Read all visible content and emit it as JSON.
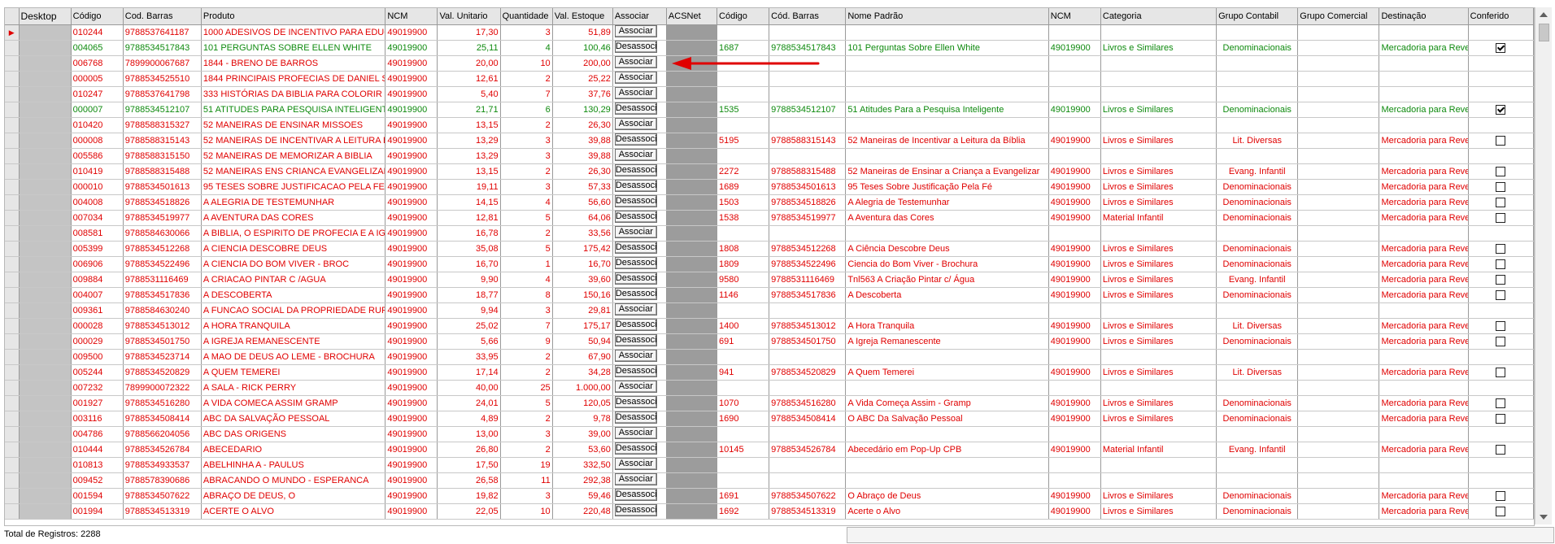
{
  "headers": {
    "desktop": "Desktop",
    "codigo": "Código",
    "cod_barras": "Cod. Barras",
    "produto": "Produto",
    "ncm": "NCM",
    "val_unitario": "Val. Unitario",
    "quantidade": "Quantidade",
    "val_estoque": "Val. Estoque",
    "associar": "Associar",
    "acsnet": "ACSNet",
    "codigo2": "Código",
    "cod_barras2": "Cód. Barras",
    "nome_padrao": "Nome Padrão",
    "ncm2": "NCM",
    "categoria": "Categoria",
    "grupo_contabil": "Grupo Contabil",
    "grupo_comercial": "Grupo Comercial",
    "destinacao": "Destinação",
    "conferido": "Conferido"
  },
  "buttons": {
    "associar": "Associar",
    "desassociar": "Desassociar"
  },
  "row_indicator": "▶",
  "rows": [
    {
      "codigo": "010244",
      "barras": "9788537641187",
      "produto": "1000 ADESIVOS DE INCENTIVO PARA EDUCA",
      "ncm": "49019900",
      "vu": "17,30",
      "qt": "3",
      "ve": "51,89",
      "btn": "Associar",
      "status": "red",
      "linked": false,
      "current": true
    },
    {
      "codigo": "004065",
      "barras": "9788534517843",
      "produto": "101 PERGUNTAS SOBRE ELLEN WHITE",
      "ncm": "49019900",
      "vu": "25,11",
      "qt": "4",
      "ve": "100,46",
      "btn": "Desassociar",
      "status": "green",
      "linked": true,
      "c2": "1687",
      "b2": "9788534517843",
      "nome": "101 Perguntas Sobre Ellen White",
      "ncm2": "49019900",
      "cat": "Livros e Similares",
      "gc": "Denominacionais",
      "gcom": "",
      "dest": "Mercadoria para Reve",
      "conf": true
    },
    {
      "codigo": "006768",
      "barras": "7899900067687",
      "produto": "1844 - BRENO DE BARROS",
      "ncm": "49019900",
      "vu": "20,00",
      "qt": "10",
      "ve": "200,00",
      "btn": "Associar",
      "status": "red",
      "linked": false
    },
    {
      "codigo": "000005",
      "barras": "9788534525510",
      "produto": "1844 PRINCIPAIS PROFECIAS DE DANIEL S",
      "ncm": "49019900",
      "vu": "12,61",
      "qt": "2",
      "ve": "25,22",
      "btn": "Associar",
      "status": "red",
      "linked": false
    },
    {
      "codigo": "010247",
      "barras": "9788537641798",
      "produto": "333 HISTÓRIAS DA BIBLIA PARA COLORIR",
      "ncm": "49019900",
      "vu": "5,40",
      "qt": "7",
      "ve": "37,76",
      "btn": "Associar",
      "status": "red",
      "linked": false
    },
    {
      "codigo": "000007",
      "barras": "9788534512107",
      "produto": "51 ATITUDES PARA PESQUISA INTELIGENTE",
      "ncm": "49019900",
      "vu": "21,71",
      "qt": "6",
      "ve": "130,29",
      "btn": "Desassociar",
      "status": "green",
      "linked": true,
      "c2": "1535",
      "b2": "9788534512107",
      "nome": "51 Atitudes Para a Pesquisa Inteligente",
      "ncm2": "49019900",
      "cat": "Livros e Similares",
      "gc": "Denominacionais",
      "gcom": "",
      "dest": "Mercadoria para Reve",
      "conf": true
    },
    {
      "codigo": "010420",
      "barras": "9788588315327",
      "produto": "52 MANEIRAS DE ENSINAR MISSOES",
      "ncm": "49019900",
      "vu": "13,15",
      "qt": "2",
      "ve": "26,30",
      "btn": "Associar",
      "status": "red",
      "linked": false
    },
    {
      "codigo": "000008",
      "barras": "9788588315143",
      "produto": "52 MANEIRAS DE INCENTIVAR A LEITURA BIB",
      "ncm": "49019900",
      "vu": "13,29",
      "qt": "3",
      "ve": "39,88",
      "btn": "Desassociar",
      "status": "red",
      "linked": true,
      "c2": "5195",
      "b2": "9788588315143",
      "nome": "52 Maneiras de Incentivar a Leitura da Bíblia",
      "ncm2": "49019900",
      "cat": "Livros e Similares",
      "gc": "Lit. Diversas",
      "gcom": "",
      "dest": "Mercadoria para Reve",
      "conf": false
    },
    {
      "codigo": "005586",
      "barras": "9788588315150",
      "produto": "52 MANEIRAS DE MEMORIZAR A BIBLIA",
      "ncm": "49019900",
      "vu": "13,29",
      "qt": "3",
      "ve": "39,88",
      "btn": "Associar",
      "status": "red",
      "linked": false
    },
    {
      "codigo": "010419",
      "barras": "9788588315488",
      "produto": "52 MANEIRAS ENS CRIANCA EVANGELIZAR",
      "ncm": "49019900",
      "vu": "13,15",
      "qt": "2",
      "ve": "26,30",
      "btn": "Desassociar",
      "status": "red",
      "linked": true,
      "c2": "2272",
      "b2": "9788588315488",
      "nome": "52 Maneiras de Ensinar a Criança a Evangelizar",
      "ncm2": "49019900",
      "cat": "Livros e Similares",
      "gc": "Evang. Infantil",
      "gcom": "",
      "dest": "Mercadoria para Reve",
      "conf": false
    },
    {
      "codigo": "000010",
      "barras": "9788534501613",
      "produto": "95 TESES SOBRE JUSTIFICACAO PELA FE",
      "ncm": "49019900",
      "vu": "19,11",
      "qt": "3",
      "ve": "57,33",
      "btn": "Desassociar",
      "status": "red",
      "linked": true,
      "c2": "1689",
      "b2": "9788534501613",
      "nome": "95 Teses Sobre Justificação Pela Fé",
      "ncm2": "49019900",
      "cat": "Livros e Similares",
      "gc": "Denominacionais",
      "gcom": "",
      "dest": "Mercadoria para Reve",
      "conf": false
    },
    {
      "codigo": "004008",
      "barras": "9788534518826",
      "produto": "A ALEGRIA DE TESTEMUNHAR",
      "ncm": "49019900",
      "vu": "14,15",
      "qt": "4",
      "ve": "56,60",
      "btn": "Desassociar",
      "status": "red",
      "linked": true,
      "c2": "1503",
      "b2": "9788534518826",
      "nome": "A Alegria de Testemunhar",
      "ncm2": "49019900",
      "cat": "Livros e Similares",
      "gc": "Denominacionais",
      "gcom": "",
      "dest": "Mercadoria para Reve",
      "conf": false
    },
    {
      "codigo": "007034",
      "barras": "9788534519977",
      "produto": "A AVENTURA DAS CORES",
      "ncm": "49019900",
      "vu": "12,81",
      "qt": "5",
      "ve": "64,06",
      "btn": "Desassociar",
      "status": "red",
      "linked": true,
      "c2": "1538",
      "b2": "9788534519977",
      "nome": "A Aventura das Cores",
      "ncm2": "49019900",
      "cat": "Material Infantil",
      "gc": "Denominacionais",
      "gcom": "",
      "dest": "Mercadoria para Reve",
      "conf": false
    },
    {
      "codigo": "008581",
      "barras": "9788584630066",
      "produto": "A BIBLIA, O ESPIRITO DE PROFECIA E A IGRE",
      "ncm": "49019900",
      "vu": "16,78",
      "qt": "2",
      "ve": "33,56",
      "btn": "Associar",
      "status": "red",
      "linked": false
    },
    {
      "codigo": "005399",
      "barras": "9788534512268",
      "produto": "A CIENCIA DESCOBRE DEUS",
      "ncm": "49019900",
      "vu": "35,08",
      "qt": "5",
      "ve": "175,42",
      "btn": "Desassociar",
      "status": "red",
      "linked": true,
      "c2": "1808",
      "b2": "9788534512268",
      "nome": "A Ciência Descobre Deus",
      "ncm2": "49019900",
      "cat": "Livros e Similares",
      "gc": "Denominacionais",
      "gcom": "",
      "dest": "Mercadoria para Reve",
      "conf": false
    },
    {
      "codigo": "006906",
      "barras": "9788534522496",
      "produto": "A CIENCIA DO BOM VIVER - BROC",
      "ncm": "49019900",
      "vu": "16,70",
      "qt": "1",
      "ve": "16,70",
      "btn": "Desassociar",
      "status": "red",
      "linked": true,
      "c2": "1809",
      "b2": "9788534522496",
      "nome": "Ciencia do Bom Viver - Brochura",
      "ncm2": "49019900",
      "cat": "Livros e Similares",
      "gc": "Denominacionais",
      "gcom": "",
      "dest": "Mercadoria para Reve",
      "conf": false
    },
    {
      "codigo": "009884",
      "barras": "9788531116469",
      "produto": "A CRIACAO PINTAR C /AGUA",
      "ncm": "49019900",
      "vu": "9,90",
      "qt": "4",
      "ve": "39,60",
      "btn": "Desassociar",
      "status": "red",
      "linked": true,
      "c2": "9580",
      "b2": "9788531116469",
      "nome": "Tnl563 A Criação Pintar c/ Água",
      "ncm2": "49019900",
      "cat": "Livros e Similares",
      "gc": "Evang. Infantil",
      "gcom": "",
      "dest": "Mercadoria para Reve",
      "conf": false
    },
    {
      "codigo": "004007",
      "barras": "9788534517836",
      "produto": "A DESCOBERTA",
      "ncm": "49019900",
      "vu": "18,77",
      "qt": "8",
      "ve": "150,16",
      "btn": "Desassociar",
      "status": "red",
      "linked": true,
      "c2": "1146",
      "b2": "9788534517836",
      "nome": "A Descoberta",
      "ncm2": "49019900",
      "cat": "Livros e Similares",
      "gc": "Denominacionais",
      "gcom": "",
      "dest": "Mercadoria para Reve",
      "conf": false
    },
    {
      "codigo": "009361",
      "barras": "9788584630240",
      "produto": "A FUNCAO SOCIAL DA PROPRIEDADE RURAL",
      "ncm": "49019900",
      "vu": "9,94",
      "qt": "3",
      "ve": "29,81",
      "btn": "Associar",
      "status": "red",
      "linked": false
    },
    {
      "codigo": "000028",
      "barras": "9788534513012",
      "produto": "A HORA TRANQUILA",
      "ncm": "49019900",
      "vu": "25,02",
      "qt": "7",
      "ve": "175,17",
      "btn": "Desassociar",
      "status": "red",
      "linked": true,
      "c2": "1400",
      "b2": "9788534513012",
      "nome": "A Hora Tranquila",
      "ncm2": "49019900",
      "cat": "Livros e Similares",
      "gc": "Lit. Diversas",
      "gcom": "",
      "dest": "Mercadoria para Reve",
      "conf": false
    },
    {
      "codigo": "000029",
      "barras": "9788534501750",
      "produto": "A IGREJA REMANESCENTE",
      "ncm": "49019900",
      "vu": "5,66",
      "qt": "9",
      "ve": "50,94",
      "btn": "Desassociar",
      "status": "red",
      "linked": true,
      "c2": "691",
      "b2": "9788534501750",
      "nome": "A Igreja Remanescente",
      "ncm2": "49019900",
      "cat": "Livros e Similares",
      "gc": "Denominacionais",
      "gcom": "",
      "dest": "Mercadoria para Reve",
      "conf": false
    },
    {
      "codigo": "009500",
      "barras": "9788534523714",
      "produto": "A MAO DE DEUS AO LEME - BROCHURA",
      "ncm": "49019900",
      "vu": "33,95",
      "qt": "2",
      "ve": "67,90",
      "btn": "Associar",
      "status": "red",
      "linked": false
    },
    {
      "codigo": "005244",
      "barras": "9788534520829",
      "produto": "A QUEM TEMEREI",
      "ncm": "49019900",
      "vu": "17,14",
      "qt": "2",
      "ve": "34,28",
      "btn": "Desassociar",
      "status": "red",
      "linked": true,
      "c2": "941",
      "b2": "9788534520829",
      "nome": "A Quem Temerei",
      "ncm2": "49019900",
      "cat": "Livros e Similares",
      "gc": "Lit. Diversas",
      "gcom": "",
      "dest": "Mercadoria para Reve",
      "conf": false
    },
    {
      "codigo": "007232",
      "barras": "7899900072322",
      "produto": "A SALA - RICK PERRY",
      "ncm": "49019900",
      "vu": "40,00",
      "qt": "25",
      "ve": "1.000,00",
      "btn": "Associar",
      "status": "red",
      "linked": false
    },
    {
      "codigo": "001927",
      "barras": "9788534516280",
      "produto": "A VIDA COMECA ASSIM GRAMP",
      "ncm": "49019900",
      "vu": "24,01",
      "qt": "5",
      "ve": "120,05",
      "btn": "Desassociar",
      "status": "red",
      "linked": true,
      "c2": "1070",
      "b2": "9788534516280",
      "nome": "A Vida Começa Assim - Gramp",
      "ncm2": "49019900",
      "cat": "Livros e Similares",
      "gc": "Denominacionais",
      "gcom": "",
      "dest": "Mercadoria para Reve",
      "conf": false
    },
    {
      "codigo": "003116",
      "barras": "9788534508414",
      "produto": "ABC DA SALVAÇÃO PESSOAL",
      "ncm": "49019900",
      "vu": "4,89",
      "qt": "2",
      "ve": "9,78",
      "btn": "Desassociar",
      "status": "red",
      "linked": true,
      "c2": "1690",
      "b2": "9788534508414",
      "nome": "O ABC Da Salvação Pessoal",
      "ncm2": "49019900",
      "cat": "Livros e Similares",
      "gc": "Denominacionais",
      "gcom": "",
      "dest": "Mercadoria para Reve",
      "conf": false
    },
    {
      "codigo": "004786",
      "barras": "9788566204056",
      "produto": "ABC DAS ORIGENS",
      "ncm": "49019900",
      "vu": "13,00",
      "qt": "3",
      "ve": "39,00",
      "btn": "Associar",
      "status": "red",
      "linked": false
    },
    {
      "codigo": "010444",
      "barras": "9788534526784",
      "produto": "ABECEDARIO",
      "ncm": "49019900",
      "vu": "26,80",
      "qt": "2",
      "ve": "53,60",
      "btn": "Desassociar",
      "status": "red",
      "linked": true,
      "c2": "10145",
      "b2": "9788534526784",
      "nome": "Abecedário em Pop-Up CPB",
      "ncm2": "49019900",
      "cat": "Material Infantil",
      "gc": "Evang. Infantil",
      "gcom": "",
      "dest": "Mercadoria para Reve",
      "conf": false
    },
    {
      "codigo": "010813",
      "barras": "9788534933537",
      "produto": "ABELHINHA A - PAULUS",
      "ncm": "49019900",
      "vu": "17,50",
      "qt": "19",
      "ve": "332,50",
      "btn": "Associar",
      "status": "red",
      "linked": false
    },
    {
      "codigo": "009452",
      "barras": "9788578390686",
      "produto": "ABRACANDO O MUNDO - ESPERANCA",
      "ncm": "49019900",
      "vu": "26,58",
      "qt": "11",
      "ve": "292,38",
      "btn": "Associar",
      "status": "red",
      "linked": false
    },
    {
      "codigo": "001594",
      "barras": "9788534507622",
      "produto": "ABRAÇO DE DEUS, O",
      "ncm": "49019900",
      "vu": "19,82",
      "qt": "3",
      "ve": "59,46",
      "btn": "Desassociar",
      "status": "red",
      "linked": true,
      "c2": "1691",
      "b2": "9788534507622",
      "nome": "O Abraço de Deus",
      "ncm2": "49019900",
      "cat": "Livros e Similares",
      "gc": "Denominacionais",
      "gcom": "",
      "dest": "Mercadoria para Reve",
      "conf": false
    },
    {
      "codigo": "001994",
      "barras": "9788534513319",
      "produto": "ACERTE O ALVO",
      "ncm": "49019900",
      "vu": "22,05",
      "qt": "10",
      "ve": "220,48",
      "btn": "Desassociar",
      "status": "red",
      "linked": true,
      "c2": "1692",
      "b2": "9788534513319",
      "nome": "Acerte o Alvo",
      "ncm2": "49019900",
      "cat": "Livros e Similares",
      "gc": "Denominacionais",
      "gcom": "",
      "dest": "Mercadoria para Reve",
      "conf": false
    }
  ],
  "status_bar": {
    "total_label": "Total de Registros: 2288"
  },
  "colors": {
    "red": "#e00000",
    "green": "#0e8a0e",
    "arrow": "#e00000"
  }
}
